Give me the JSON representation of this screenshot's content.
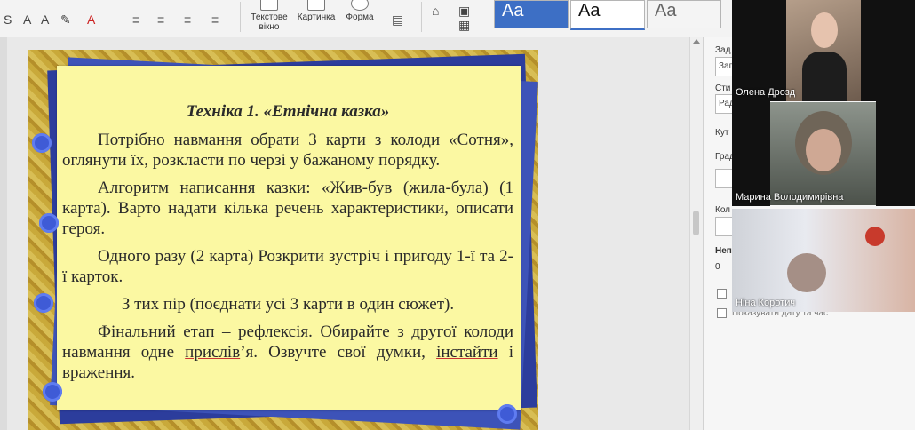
{
  "ribbon": {
    "insert_textbox_label": "Текстове вікно",
    "picture_label": "Картинка",
    "shape_label": "Форма",
    "style_preview_text": "Aa"
  },
  "slide": {
    "title": "Техніка 1. «Етнічна казка»",
    "paragraphs": [
      "Потрібно навмання обрати 3 карти з колоди «Сотня», оглянути їх, розкласти по черзі у бажаному порядку.",
      "Алгоритм написання казки: «Жив-був (жила-була) (1 карта). Варто надати кілька речень характеристики, описати героя.",
      "Одного разу (2 карта) Розкрити зустріч і пригоду 1-ї та 2-ї карток.",
      "З тих пір (поєднати усі 3 карти в один сюжет).",
      "Фінальний етап – рефлексія. Обирайте з другої колоди навмання одне"
    ],
    "p5_word1": "прислів",
    "p5_mid": "’я. Озвучте свої думки, ",
    "p5_word2": "інстайти",
    "p5_end": " і враження."
  },
  "right_panel": {
    "label_header": "Зад",
    "field1": "Заг",
    "label_style": "Сти",
    "field2": "Рад",
    "label_angle": "Кут",
    "label_gradient": "Град",
    "label_color": "Кол",
    "label_transparency": "Неп",
    "transparency_value": "0",
    "show_date_label": "Показувати дату та час"
  },
  "participants": [
    {
      "name": "Олена Дрозд"
    },
    {
      "name": "Марина Володимирівна"
    },
    {
      "name": "Ніна Коротич"
    }
  ]
}
